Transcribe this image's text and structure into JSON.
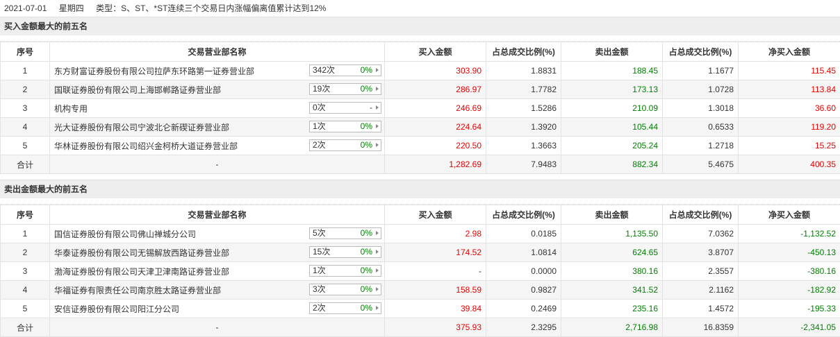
{
  "info": {
    "date": "2021-07-01",
    "weekday": "星期四",
    "type": "类型：S、ST、*ST连续三个交易日内涨幅偏离值累计达到12%"
  },
  "columns": [
    "序号",
    "交易营业部名称",
    "买入金额",
    "占总成交比例(%)",
    "卖出金额",
    "占总成交比例(%)",
    "净买入金额"
  ],
  "buy_section": {
    "title": "买入金额最大的前五名",
    "rows": [
      {
        "seq": "1",
        "name": "东方财富证券股份有限公司拉萨东环路第一证券营业部",
        "count": "342次",
        "pct": "0%",
        "buy": "303.90",
        "buy_ratio": "1.8831",
        "sell": "188.45",
        "sell_ratio": "1.1677",
        "net": "115.45"
      },
      {
        "seq": "2",
        "name": "国联证券股份有限公司上海邯郸路证券营业部",
        "count": "19次",
        "pct": "0%",
        "buy": "286.97",
        "buy_ratio": "1.7782",
        "sell": "173.13",
        "sell_ratio": "1.0728",
        "net": "113.84"
      },
      {
        "seq": "3",
        "name": "机构专用",
        "count": "0次",
        "pct": "-",
        "buy": "246.69",
        "buy_ratio": "1.5286",
        "sell": "210.09",
        "sell_ratio": "1.3018",
        "net": "36.60"
      },
      {
        "seq": "4",
        "name": "光大证券股份有限公司宁波北仑新碶证券营业部",
        "count": "1次",
        "pct": "0%",
        "buy": "224.64",
        "buy_ratio": "1.3920",
        "sell": "105.44",
        "sell_ratio": "0.6533",
        "net": "119.20"
      },
      {
        "seq": "5",
        "name": "华林证券股份有限公司绍兴金柯桥大道证券营业部",
        "count": "2次",
        "pct": "0%",
        "buy": "220.50",
        "buy_ratio": "1.3663",
        "sell": "205.24",
        "sell_ratio": "1.2718",
        "net": "15.25"
      }
    ],
    "total": {
      "label": "合计",
      "name": "-",
      "buy": "1,282.69",
      "buy_ratio": "7.9483",
      "sell": "882.34",
      "sell_ratio": "5.4675",
      "net": "400.35"
    }
  },
  "sell_section": {
    "title": "卖出金额最大的前五名",
    "rows": [
      {
        "seq": "1",
        "name": "国信证券股份有限公司佛山禅城分公司",
        "count": "5次",
        "pct": "0%",
        "buy": "2.98",
        "buy_ratio": "0.0185",
        "sell": "1,135.50",
        "sell_ratio": "7.0362",
        "net": "-1,132.52"
      },
      {
        "seq": "2",
        "name": "华泰证券股份有限公司无锡解放西路证券营业部",
        "count": "15次",
        "pct": "0%",
        "buy": "174.52",
        "buy_ratio": "1.0814",
        "sell": "624.65",
        "sell_ratio": "3.8707",
        "net": "-450.13"
      },
      {
        "seq": "3",
        "name": "渤海证券股份有限公司天津卫津南路证券营业部",
        "count": "1次",
        "pct": "0%",
        "buy": "-",
        "buy_ratio": "0.0000",
        "sell": "380.16",
        "sell_ratio": "2.3557",
        "net": "-380.16"
      },
      {
        "seq": "4",
        "name": "华福证券有限责任公司南京胜太路证券营业部",
        "count": "3次",
        "pct": "0%",
        "buy": "158.59",
        "buy_ratio": "0.9827",
        "sell": "341.52",
        "sell_ratio": "2.1162",
        "net": "-182.92"
      },
      {
        "seq": "5",
        "name": "安信证券股份有限公司阳江分公司",
        "count": "2次",
        "pct": "0%",
        "buy": "39.84",
        "buy_ratio": "0.2469",
        "sell": "235.16",
        "sell_ratio": "1.4572",
        "net": "-195.33"
      }
    ],
    "total": {
      "label": "合计",
      "name": "-",
      "buy": "375.93",
      "buy_ratio": "2.3295",
      "sell": "2,716.98",
      "sell_ratio": "16.8359",
      "net": "-2,341.05"
    }
  },
  "colors": {
    "positive": "#e60000",
    "negative": "#008000",
    "alt_row": "#f5f5f5",
    "section_bg": "#eeeeee"
  }
}
